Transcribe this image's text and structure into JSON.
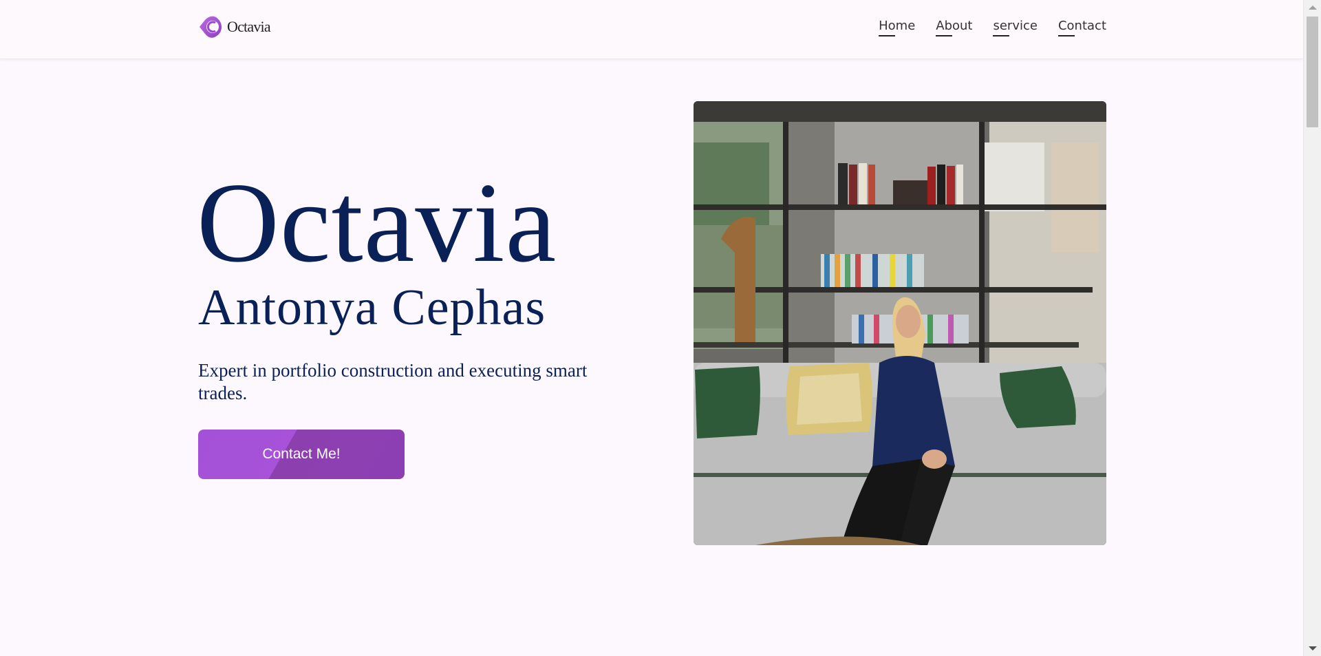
{
  "brand": {
    "name": "Octavia",
    "icon": "octavia-logo-icon",
    "color": "#a451d8"
  },
  "nav": {
    "items": [
      {
        "label": "Home"
      },
      {
        "label": "About"
      },
      {
        "label": "service"
      },
      {
        "label": "Contact"
      }
    ]
  },
  "hero": {
    "title": "Octavia",
    "subtitle": "Antonya Cephas",
    "tagline": "Expert in portfolio construction and executing smart trades.",
    "cta_label": "Contact Me!",
    "text_color": "#0a2158",
    "button_colors": [
      "#a451d8",
      "#8c40b0"
    ]
  },
  "photo": {
    "icon": "portrait-photo"
  },
  "colors": {
    "background": "#fdf8fd",
    "nav_text": "#333333"
  }
}
